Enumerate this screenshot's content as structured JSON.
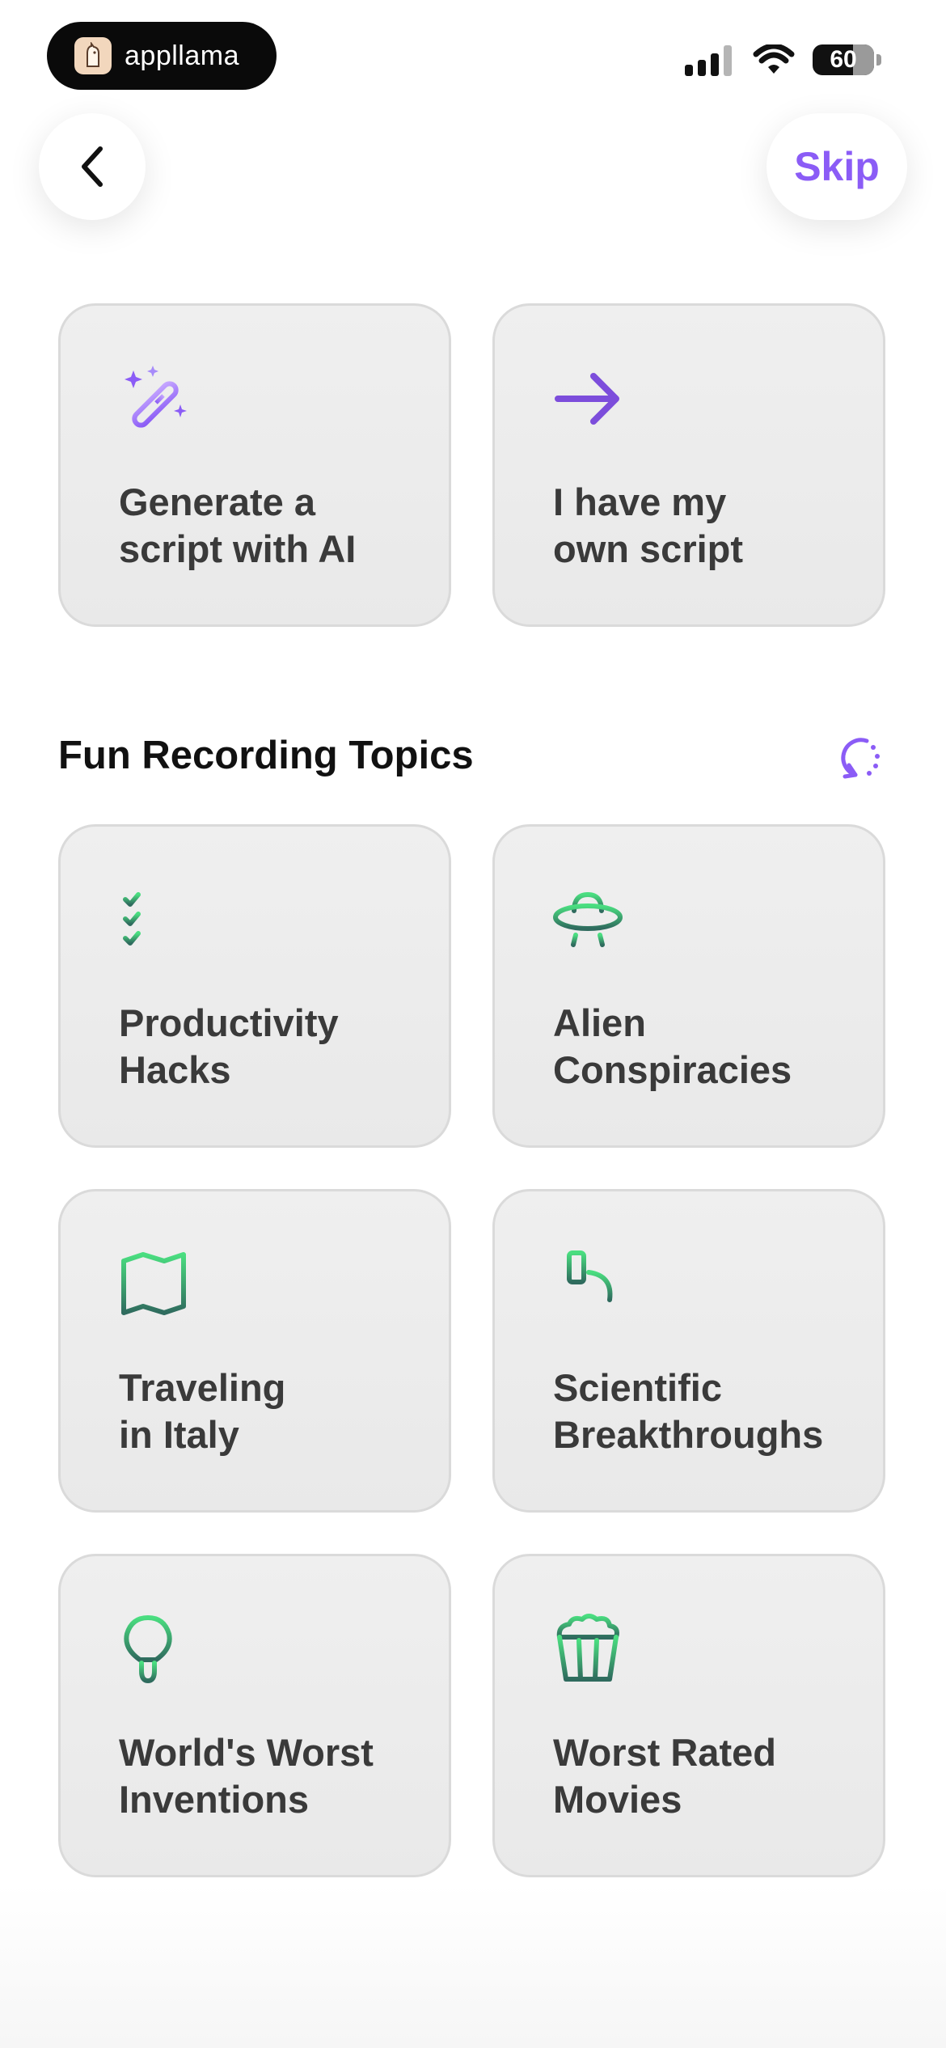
{
  "status_bar": {
    "brand": "appllama",
    "battery_level": "60"
  },
  "nav": {
    "skip_label": "Skip"
  },
  "options": [
    {
      "label": "Generate a\nscript with AI",
      "icon": "magic-wand-icon"
    },
    {
      "label": "I have my\nown script",
      "icon": "arrow-right-icon"
    }
  ],
  "topics": {
    "title": "Fun Recording Topics",
    "items": [
      {
        "label": "Productivity\nHacks",
        "icon": "checklist-icon"
      },
      {
        "label": "Alien\nConspiracies",
        "icon": "ufo-icon"
      },
      {
        "label": "Traveling\nin Italy",
        "icon": "map-icon"
      },
      {
        "label": "Scientific\nBreakthroughs",
        "icon": "microscope-icon"
      },
      {
        "label": "World's Worst\nInventions",
        "icon": "lightbulb-icon"
      },
      {
        "label": "Worst Rated\nMovies",
        "icon": "popcorn-icon"
      }
    ]
  },
  "colors": {
    "accent": "#8b5cf6",
    "topic_icon_start": "#4ade80",
    "topic_icon_end": "#2f6b5e",
    "card_bg": "#ececec"
  }
}
